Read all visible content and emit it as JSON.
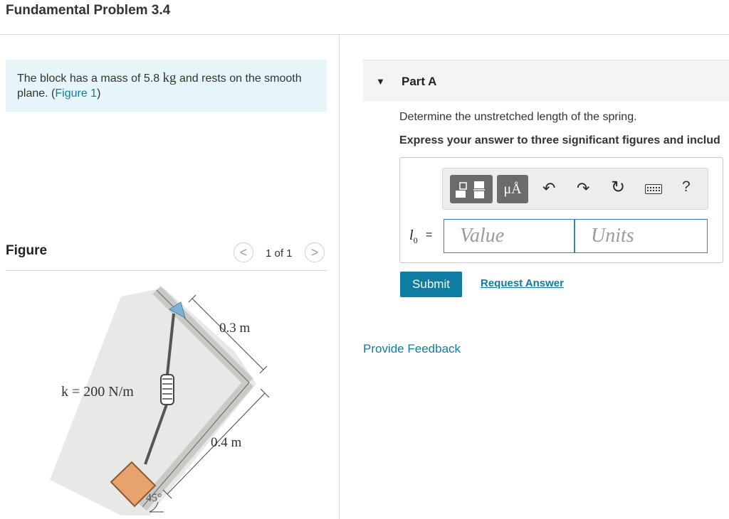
{
  "header": {
    "title": "Fundamental Problem 3.4"
  },
  "intro": {
    "text_before": "The block has a mass of 5.8 ",
    "unit_kg": "kg",
    "text_after": " and rests on the smooth plane. (",
    "figure_link": "Figure 1",
    "text_end": ")"
  },
  "figure": {
    "label": "Figure",
    "pager": {
      "prev": "<",
      "count": "1 of 1",
      "next": ">"
    },
    "spring_label": "k = 200 N/m",
    "dim_top": "0.3 m",
    "dim_bottom": "0.4 m",
    "angle": "45°"
  },
  "part": {
    "caret": "▼",
    "title": "Part A",
    "question": "Determine the unstretched length of the spring.",
    "instruction": "Express your answer to three significant figures and includ"
  },
  "answer": {
    "variable": "l",
    "variable_sub": "0",
    "equals": "=",
    "value_placeholder": "Value",
    "units_placeholder": "Units"
  },
  "toolbar": {
    "units_symbol": "μÅ",
    "undo_icon": "undo-icon",
    "redo_icon": "redo-icon",
    "reset_icon": "reset-icon",
    "keyboard_icon": "keyboard-icon",
    "help": "?"
  },
  "actions": {
    "submit": "Submit",
    "request_answer": "Request Answer",
    "feedback": "Provide Feedback"
  },
  "colors": {
    "accent": "#0f7da2",
    "intro_bg": "#e6f5f7",
    "block": "#e7a36b"
  }
}
